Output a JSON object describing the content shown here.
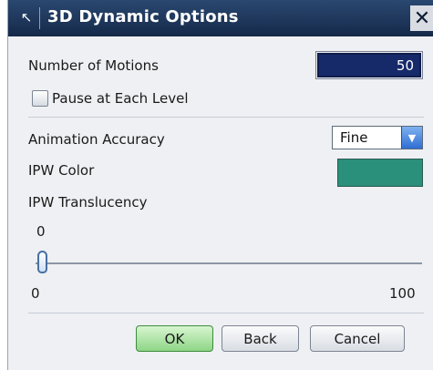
{
  "window": {
    "title": "3D Dynamic Options",
    "close_glyph": "✕",
    "pin_glyph": "↖"
  },
  "motions": {
    "label": "Number of Motions",
    "value": "50"
  },
  "pause": {
    "label": "Pause at Each Level",
    "checked": false
  },
  "accuracy": {
    "label": "Animation Accuracy",
    "selected": "Fine"
  },
  "ipw_color": {
    "label": "IPW Color",
    "color": "#2a8f7b"
  },
  "translucency": {
    "label": "IPW Translucency",
    "value": "0",
    "min": "0",
    "max": "100",
    "level": 0
  },
  "buttons": {
    "ok": "OK",
    "back": "Back",
    "cancel": "Cancel"
  },
  "colors": {
    "title_bar": "#15294a",
    "input_bg": "#162a6a",
    "ok_button": "#8ed687",
    "dropdown_button": "#2f6ed3"
  }
}
